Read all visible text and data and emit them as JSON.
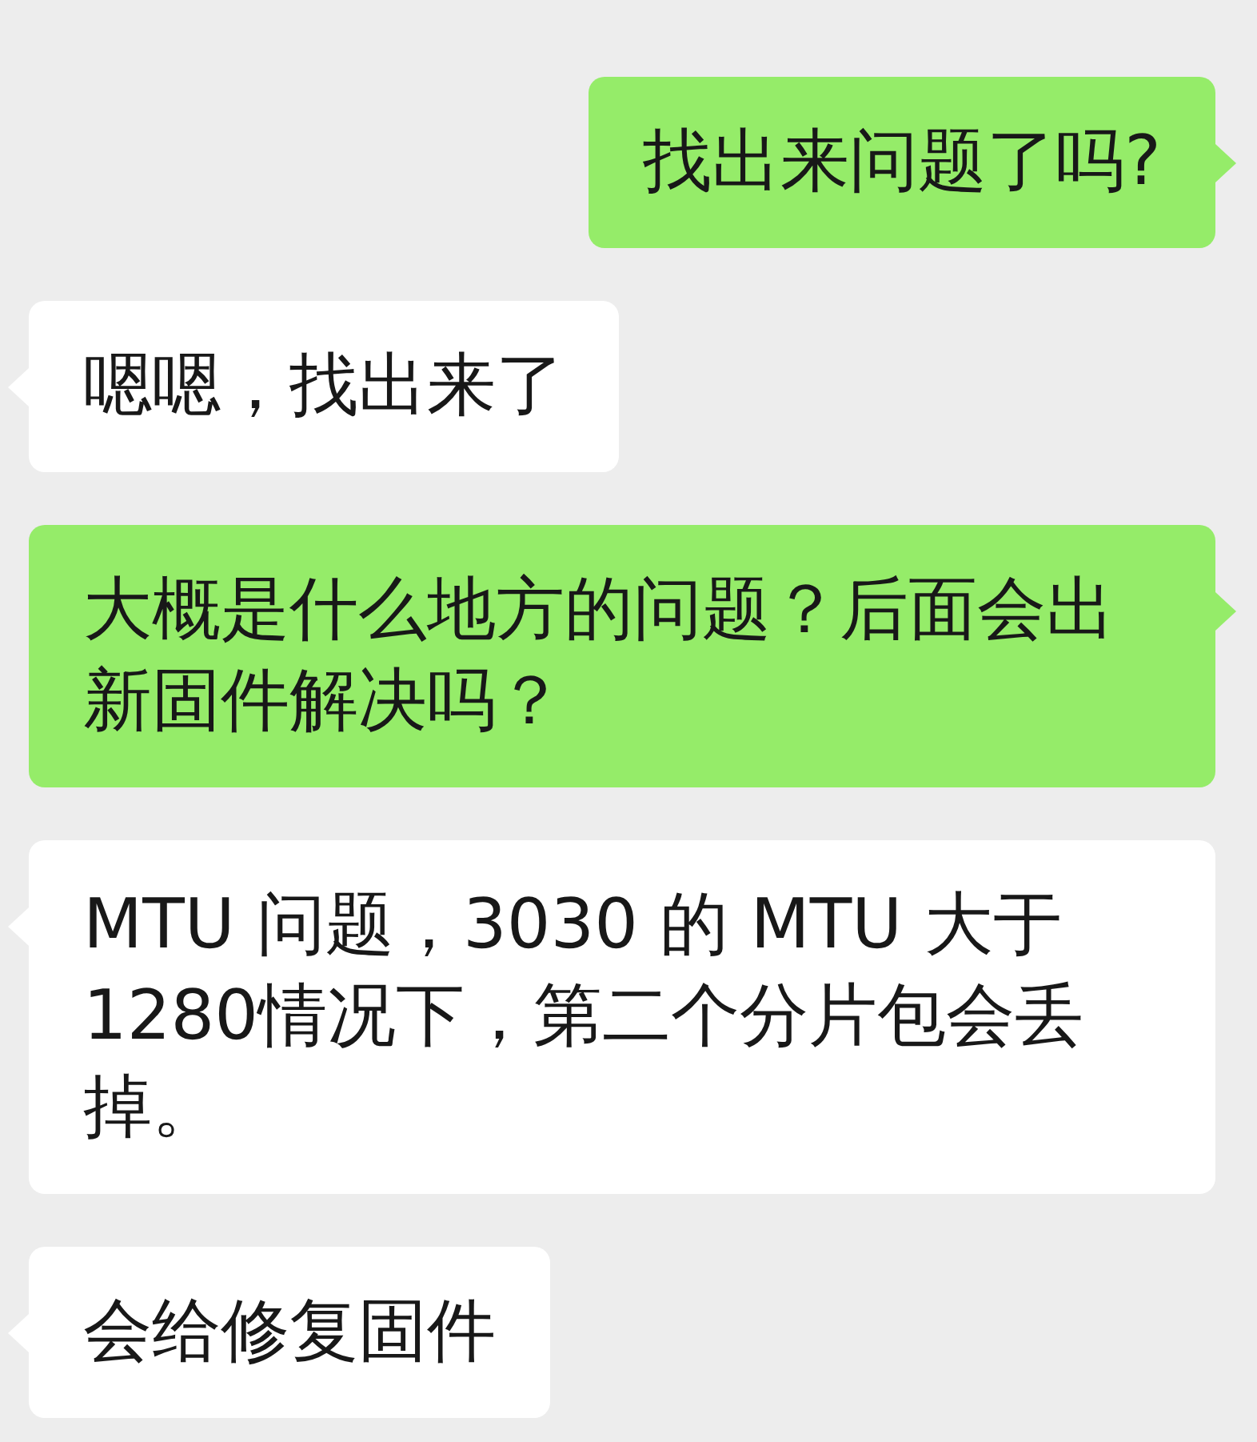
{
  "messages": [
    {
      "kind": "sent",
      "text": "找出来问题了吗?"
    },
    {
      "kind": "received",
      "text": "嗯嗯，找出来了"
    },
    {
      "kind": "sent",
      "text": "大概是什么地方的问题？后面会出新固件解决吗？"
    },
    {
      "kind": "received",
      "text": "MTU 问题，3030 的 MTU 大于 1280情况下，第二个分片包会丢掉。"
    },
    {
      "kind": "received",
      "text": "会给修复固件"
    }
  ]
}
